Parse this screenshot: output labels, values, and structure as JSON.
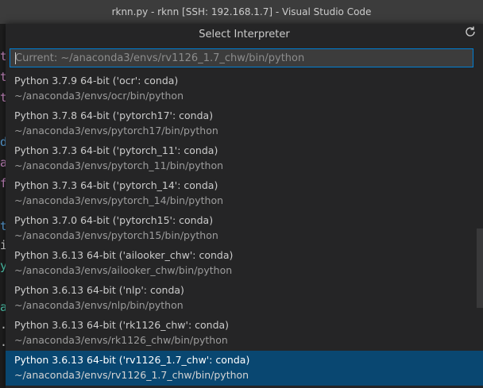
{
  "window": {
    "title": "rknn.py - rknn [SSH: 192.168.1.7] - Visual Studio Code"
  },
  "picker": {
    "title": "Select Interpreter",
    "refresh_icon": "refresh-icon",
    "input_placeholder": "Current: ~/anaconda3/envs/rv1126_1.7_chw/bin/python",
    "items": [
      {
        "label": "Python 3.7.9 64-bit ('ocr': conda)",
        "detail": "~/anaconda3/envs/ocr/bin/python"
      },
      {
        "label": "Python 3.7.8 64-bit ('pytorch17': conda)",
        "detail": "~/anaconda3/envs/pytorch17/bin/python"
      },
      {
        "label": "Python 3.7.3 64-bit ('pytorch_11': conda)",
        "detail": "~/anaconda3/envs/pytorch_11/bin/python"
      },
      {
        "label": "Python 3.7.3 64-bit ('pytorch_14': conda)",
        "detail": "~/anaconda3/envs/pytorch_14/bin/python"
      },
      {
        "label": "Python 3.7.0 64-bit ('pytorch15': conda)",
        "detail": "~/anaconda3/envs/pytorch15/bin/python"
      },
      {
        "label": "Python 3.6.13 64-bit ('ailooker_chw': conda)",
        "detail": "~/anaconda3/envs/ailooker_chw/bin/python"
      },
      {
        "label": "Python 3.6.13 64-bit ('nlp': conda)",
        "detail": "~/anaconda3/envs/nlp/bin/python"
      },
      {
        "label": "Python 3.6.13 64-bit ('rk1126_chw': conda)",
        "detail": "~/anaconda3/envs/rk1126_chw/bin/python"
      },
      {
        "label": "Python 3.6.13 64-bit ('rv1126_1.7_chw': conda)",
        "detail": "~/anaconda3/envs/rv1126_1.7_chw/bin/python",
        "selected": true
      }
    ]
  },
  "editor": {
    "gutter": [
      {
        "char": "t",
        "color": "#c586c0"
      },
      {
        "char": "t",
        "color": "#c586c0"
      },
      {
        "char": "t",
        "color": "#c586c0"
      },
      {
        "char": "d",
        "color": "#569cd6"
      },
      {
        "char": "a",
        "color": "#c586c0"
      },
      {
        "char": "f",
        "color": "#c586c0"
      },
      {
        "char": "t",
        "color": "#569cd6"
      },
      {
        "char": "i",
        "color": "#d4d4d4"
      },
      {
        "char": "y",
        "color": "#4ec9b0"
      },
      {
        "char": "a",
        "color": "#4ec9b0"
      },
      {
        "char": ".",
        "color": "#d4d4d4"
      },
      {
        "char": ".",
        "color": "#d4d4d4"
      }
    ]
  },
  "colors": {
    "selection": "#094771",
    "focus_border": "#007fd4"
  }
}
